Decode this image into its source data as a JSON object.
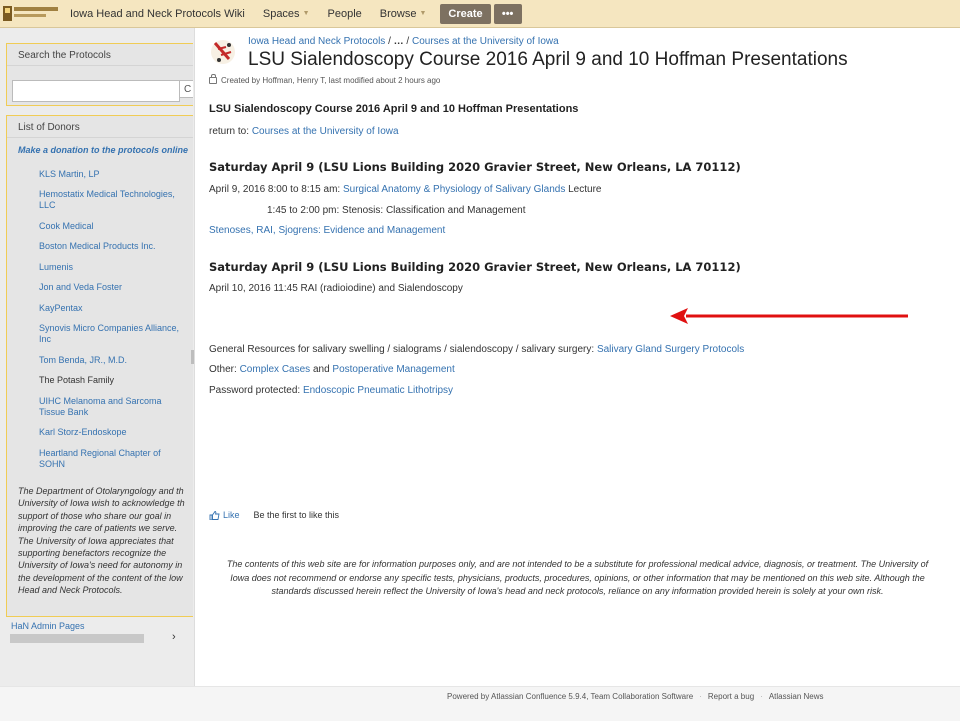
{
  "topbar": {
    "site_title": "Iowa Head and Neck Protocols Wiki",
    "nav": [
      "Spaces",
      "People",
      "Browse"
    ],
    "create_label": "Create",
    "more_label": "•••"
  },
  "sidebar": {
    "search_heading": "Search the Protocols",
    "search_value": "",
    "search_button_label": "C",
    "donors_heading": "List of Donors",
    "donate_link": "Make a donation to the protocols online",
    "donors": [
      "KLS Martin, LP",
      "Hemostatix Medical Technologies, LLC",
      "Cook Medical",
      "Boston Medical Products Inc.",
      "Lumenis",
      "Jon and Veda Foster",
      "KayPentax",
      "Synovis Micro Companies Alliance, Inc",
      "Tom Benda, JR., M.D.",
      "The Potash Family",
      "UIHC Melanoma and Sarcoma Tissue Bank",
      "Karl Storz-Endoskope",
      "Heartland Regional Chapter of SOHN"
    ],
    "about_lines": [
      "The Department of Otolaryngology and th",
      "University of Iowa wish to acknowledge th",
      "support of those who share our goal in",
      "improving the care of patients we serve.",
      "The University of Iowa appreciates that",
      "supporting benefactors recognize the",
      "University of Iowa's need for autonomy in",
      "the development of the content of the low",
      "Head and Neck Protocols."
    ],
    "admin_link": "HaN Admin Pages",
    "scroll_arrow": "›"
  },
  "page": {
    "breadcrumb": {
      "root": "Iowa Head and Neck Protocols",
      "sep1": "/",
      "ellipsis": "…",
      "sep2": "/",
      "parent": "Courses at the University of Iowa"
    },
    "title": "LSU Sialendoscopy Course 2016 April 9 and 10 Hoffman Presentations",
    "meta": "Created by Hoffman, Henry T, last modified about 2 hours ago",
    "heading": "LSU Sialendoscopy Course 2016 April 9 and 10 Hoffman Presentations",
    "return_prefix": "return to: ",
    "return_link": "Courses at the University of Iowa",
    "section1_heading": "Saturday April 9 (LSU Lions Building  2020 Gravier Street, New Orleans, LA 70112)",
    "item1_prefix": "April 9, 2016 8:00 to 8:15 am: ",
    "item1_link": "Surgical Anatomy & Physiology of Salivary Glands",
    "item1_suffix": " Lecture",
    "item2": "1:45 to 2:00 pm: Stenosis: Classification and Management",
    "item3_link": "Stenoses, RAI, Sjogrens: Evidence and Management",
    "section2_heading": "Saturday April 9 (LSU Lions Building  2020 Gravier Street, New Orleans, LA 70112)",
    "item4": "April 10, 2016 11:45 RAI (radioiodine) and Sialendoscopy",
    "general_prefix": "General Resources for salivary swelling / sialograms / sialendoscopy / salivary surgery: ",
    "general_link": "Salivary Gland Surgery Protocols",
    "other_prefix": "Other:  ",
    "other_link1": "Complex Cases",
    "other_mid": " and ",
    "other_link2": "Postoperative Management",
    "password_prefix": "Password protected: ",
    "password_link": "Endoscopic Pneumatic Lithotripsy",
    "like_label": "Like",
    "like_text": "Be the first to like this",
    "disclaimer": "The contents of this web site are for information purposes only, and are not intended to be a substitute for professional medical advice, diagnosis, or treatment. The University of Iowa does not recommend or endorse any specific tests, physicians, products, procedures, opinions, or other information that may be mentioned on this web site. Although the standards discussed herein reflect the University of Iowa's head and neck protocols, reliance on any information provided herein is solely at your own risk."
  },
  "footer": {
    "powered": "Powered by Atlassian Confluence 5.9.4, Team Collaboration Software",
    "sep": "·",
    "report": "Report a bug",
    "news": "Atlassian News"
  },
  "colors": {
    "topbar_bg": "#f5e6c0",
    "button_bg": "#7d7161",
    "link": "#3572b0",
    "arrow": "#e01010",
    "panel_border": "#f0cc55"
  }
}
